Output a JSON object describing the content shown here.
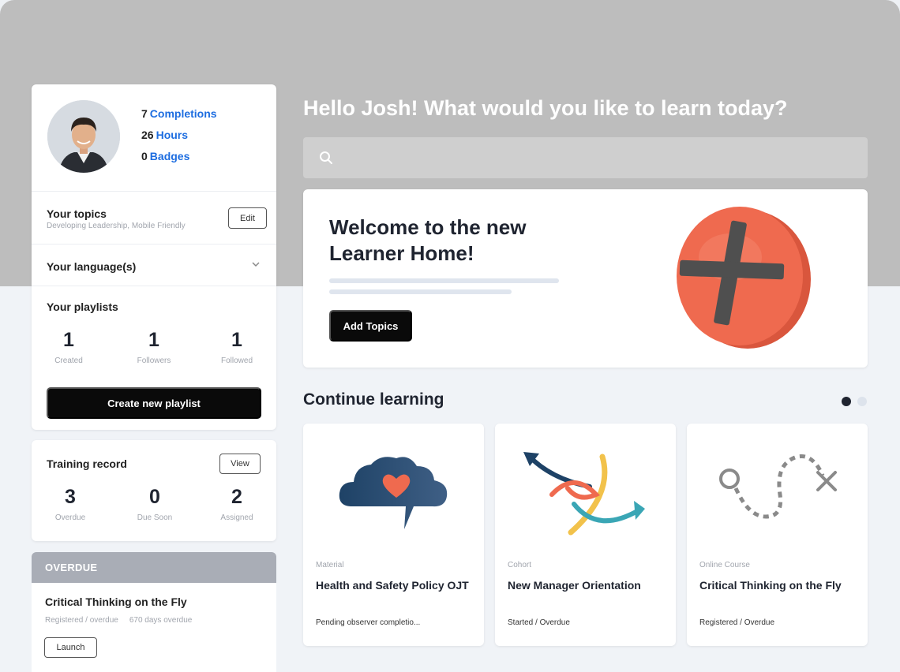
{
  "profile": {
    "completions_count": "7",
    "completions_label": "Completions",
    "hours_count": "26",
    "hours_label": "Hours",
    "badges_count": "0",
    "badges_label": "Badges"
  },
  "topics": {
    "title": "Your topics",
    "subtitle": "Developing Leadership, Mobile Friendly",
    "edit_label": "Edit"
  },
  "language": {
    "title": "Your language(s)"
  },
  "playlists": {
    "title": "Your playlists",
    "stats": [
      {
        "value": "1",
        "label": "Created"
      },
      {
        "value": "1",
        "label": "Followers"
      },
      {
        "value": "1",
        "label": "Followed"
      }
    ],
    "create_label": "Create new playlist"
  },
  "training": {
    "title": "Training record",
    "view_label": "View",
    "stats": [
      {
        "value": "3",
        "label": "Overdue"
      },
      {
        "value": "0",
        "label": "Due Soon"
      },
      {
        "value": "2",
        "label": "Assigned"
      }
    ]
  },
  "overdue": {
    "header": "OVERDUE",
    "item_title": "Critical Thinking on the Fly",
    "status": "Registered / overdue",
    "days": "670 days overdue",
    "launch_label": "Launch"
  },
  "main": {
    "greeting": "Hello Josh! What would you like to learn today?",
    "search_placeholder": ""
  },
  "welcome": {
    "title": "Welcome to the new Learner Home!",
    "button_label": "Add Topics"
  },
  "continue": {
    "title": "Continue learning",
    "courses": [
      {
        "type": "Material",
        "title": "Health and Safety Policy OJT",
        "status": "Pending observer completio..."
      },
      {
        "type": "Cohort",
        "title": "New Manager Orientation",
        "status": "Started / Overdue"
      },
      {
        "type": "Online Course",
        "title": "Critical Thinking on the Fly",
        "status": "Registered / Overdue"
      }
    ]
  },
  "colors": {
    "accent_link": "#1d6de0",
    "primary_button": "#0a0a0a",
    "overdue_header": "#a9adb6",
    "plus_orange": "#ef6a4f"
  },
  "icons": {
    "search": "search-icon",
    "chevron": "chevron-down-icon"
  }
}
